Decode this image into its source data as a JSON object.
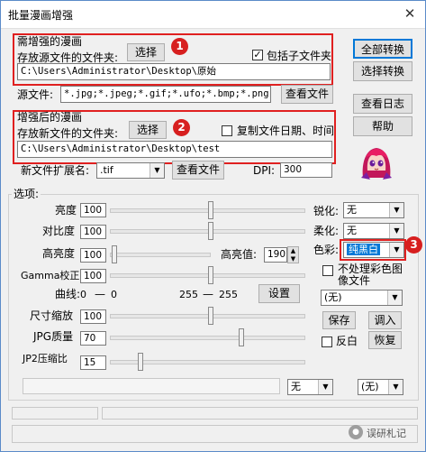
{
  "window": {
    "title": "批量漫画增强",
    "close_glyph": "✕"
  },
  "source": {
    "group_title": "需增强的漫画",
    "folder_label": "存放源文件的文件夹:",
    "choose_button": "选择",
    "include_subfolders_label": "包括子文件夹",
    "include_subfolders_checked": true,
    "path": "C:\\Users\\Administrator\\Desktop\\原始",
    "files_label": "源文件:",
    "files_filter": "*.jpg;*.jpeg;*.gif;*.ufo;*.bmp;*.png",
    "view_files_button": "查看文件"
  },
  "target": {
    "group_title": "增强后的漫画",
    "folder_label": "存放新文件的文件夹:",
    "choose_button": "选择",
    "copy_date_label": "复制文件日期、时间",
    "copy_date_checked": false,
    "path": "C:\\Users\\Administrator\\Desktop\\test",
    "ext_label": "新文件扩展名:",
    "ext_value": ".tif",
    "view_files_button": "查看文件",
    "dpi_label": "DPI:",
    "dpi_value": "300"
  },
  "side_buttons": {
    "convert_all": "全部转换",
    "convert_selected": "选择转换",
    "view_log": "查看日志",
    "help": "帮助"
  },
  "annotations": {
    "badge1": "1",
    "badge2": "2",
    "badge3": "3"
  },
  "options": {
    "group_title": "选项:",
    "brightness": {
      "label": "亮度",
      "value": "100",
      "level": 0.5
    },
    "contrast": {
      "label": "对比度",
      "value": "100",
      "level": 0.5
    },
    "highlight": {
      "label": "高亮度",
      "value": "100",
      "level": 0.03
    },
    "highlight_value_label": "高亮值:",
    "highlight_value": "190",
    "gamma": {
      "label": "Gamma校正",
      "value": "100",
      "level": 0.5
    },
    "curve": {
      "label": "曲线:",
      "v1": "0",
      "v2": "0",
      "v3": "255",
      "v4": "255",
      "setup_button": "设置"
    },
    "resize": {
      "label": "尺寸缩放",
      "value": "100",
      "level": 0.5
    },
    "jpg": {
      "label": "JPG质量",
      "value": "70",
      "level": 0.7
    },
    "jp2": {
      "label": "JP2压缩比",
      "value": "15",
      "level": 0.15
    },
    "sharpen_label": "锐化:",
    "sharpen_value": "无",
    "soften_label": "柔化:",
    "soften_value": "无",
    "color_label": "色彩:",
    "color_value": "纯黑白",
    "no_color_label_line1": "不处理彩色图",
    "no_color_label_line2": "像文件",
    "preset_value": "(无)",
    "save_button": "保存",
    "load_button": "调入",
    "invert_label": "反白",
    "restore_button": "恢复",
    "bottom_combo1": "无",
    "bottom_combo2": "(无)"
  },
  "watermark": "误研札记"
}
